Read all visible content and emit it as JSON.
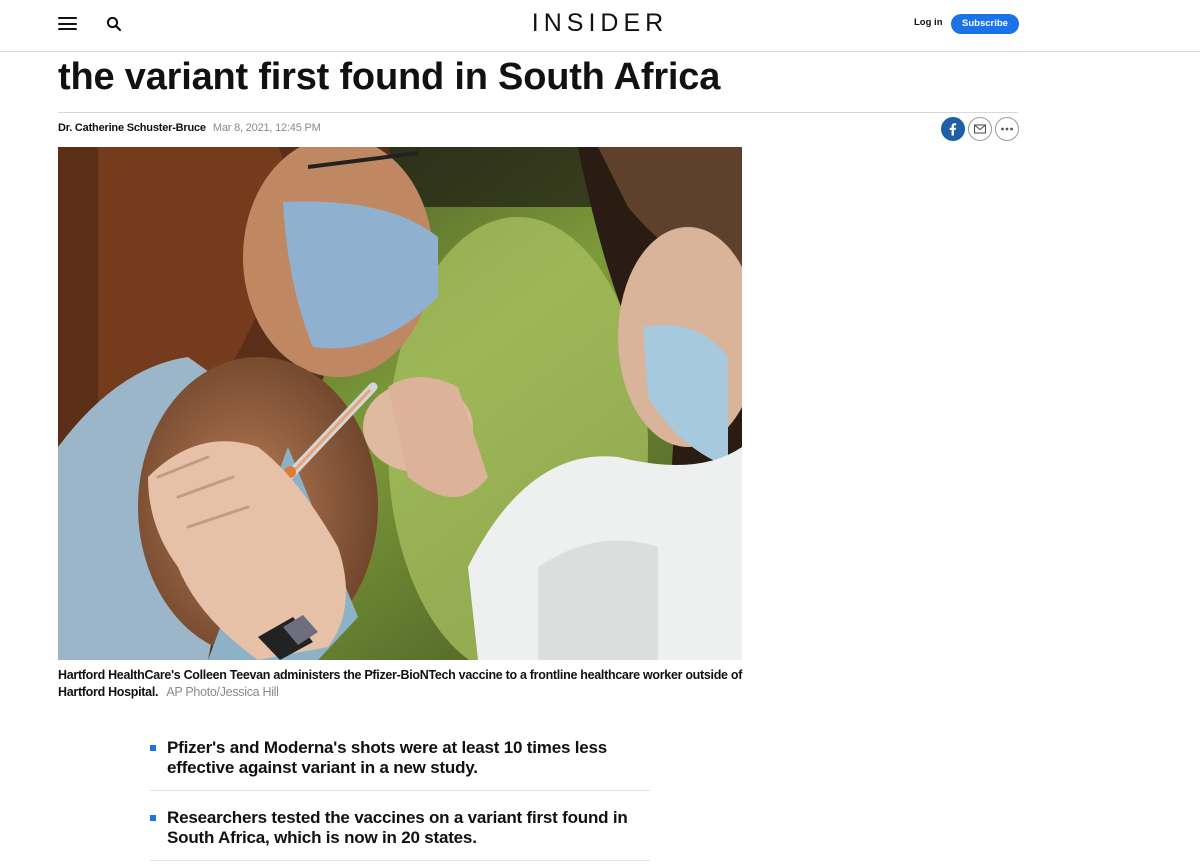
{
  "header": {
    "brand": "INSIDER",
    "login_label": "Log in",
    "subscribe_label": "Subscribe",
    "menu_icon": "menu-icon",
    "search_icon": "search-icon"
  },
  "article": {
    "headline_visible": "the variant first found in South Africa",
    "author": "Dr. Catherine Schuster-Bruce",
    "date": "Mar 8, 2021, 12:45 PM",
    "share": [
      "facebook-icon",
      "email-icon",
      "more-icon"
    ],
    "image_caption": "Hartford HealthCare's Colleen Teevan administers the Pfizer-BioNTech vaccine to a frontline healthcare worker outside of Hartford Hospital.",
    "image_credit": "AP Photo/Jessica Hill",
    "key_points": [
      "Pfizer's and Moderna's shots were at least 10 times less effective against variant in a new study.",
      "Researchers tested the vaccines on a variant first found in South Africa, which is now in 20 states."
    ]
  },
  "colors": {
    "accent": "#1a73e8",
    "facebook": "#1f5fa8",
    "muted_text": "#8a8a8a"
  }
}
